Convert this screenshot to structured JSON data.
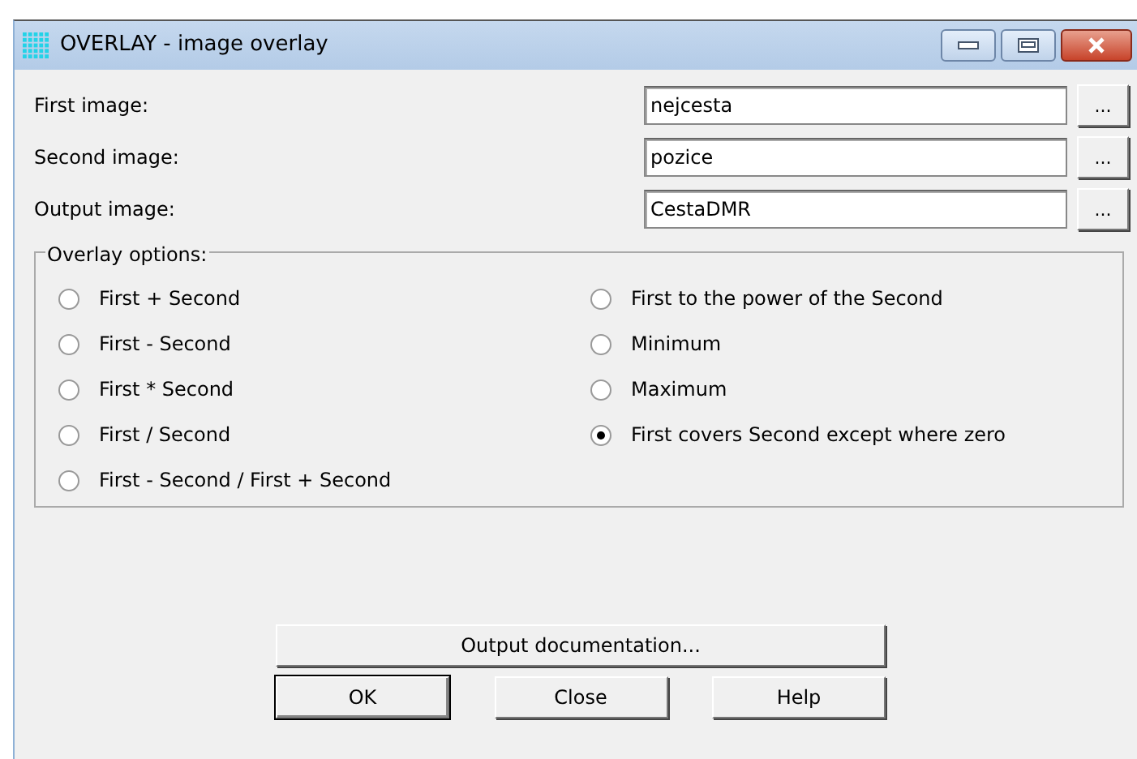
{
  "window": {
    "title": "OVERLAY - image overlay"
  },
  "fields": [
    {
      "label": "First image:",
      "value": "nejcesta",
      "browse": "..."
    },
    {
      "label": "Second image:",
      "value": "pozice",
      "browse": "..."
    },
    {
      "label": "Output image:",
      "value": "CestaDMR",
      "browse": "..."
    }
  ],
  "overlay_options": {
    "title": "Overlay options:",
    "columns": [
      [
        {
          "label": "First + Second",
          "selected": false
        },
        {
          "label": "First - Second",
          "selected": false
        },
        {
          "label": "First * Second",
          "selected": false
        },
        {
          "label": "First / Second",
          "selected": false
        },
        {
          "label": "First - Second / First + Second",
          "selected": false
        }
      ],
      [
        {
          "label": "First to the power of the Second",
          "selected": false
        },
        {
          "label": "Minimum",
          "selected": false
        },
        {
          "label": "Maximum",
          "selected": false
        },
        {
          "label": "First covers Second except where zero",
          "selected": true
        }
      ]
    ]
  },
  "doc_button": "Output documentation...",
  "buttons": [
    {
      "label": "OK",
      "kind": "default"
    },
    {
      "label": "Close",
      "kind": "normal"
    },
    {
      "label": "Help",
      "kind": "normal"
    }
  ]
}
